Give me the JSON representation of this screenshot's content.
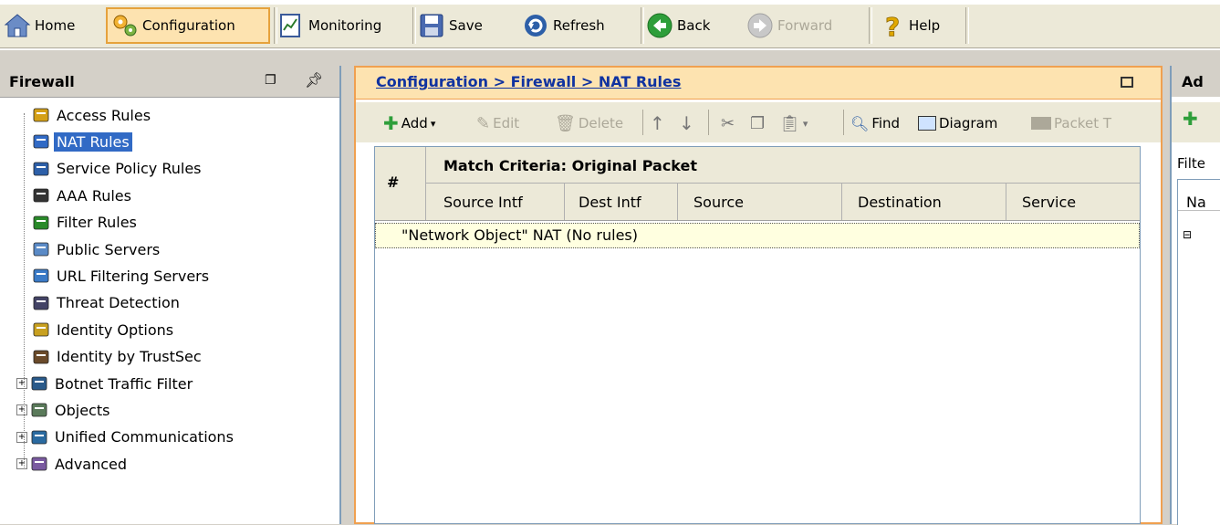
{
  "toolbar": {
    "home": "Home",
    "configuration": "Configuration",
    "monitoring": "Monitoring",
    "save": "Save",
    "refresh": "Refresh",
    "back": "Back",
    "forward": "Forward",
    "help": "Help"
  },
  "left": {
    "title": "Firewall",
    "items": [
      {
        "label": "Access Rules",
        "icon": "access-rules-icon"
      },
      {
        "label": "NAT Rules",
        "icon": "nat-rules-icon",
        "selected": true
      },
      {
        "label": "Service Policy Rules",
        "icon": "magnifier-icon"
      },
      {
        "label": "AAA Rules",
        "icon": "lock-icon"
      },
      {
        "label": "Filter Rules",
        "icon": "filter-icon"
      },
      {
        "label": "Public Servers",
        "icon": "server-icon"
      },
      {
        "label": "URL Filtering Servers",
        "icon": "url-icon"
      },
      {
        "label": "Threat Detection",
        "icon": "threat-icon"
      },
      {
        "label": "Identity Options",
        "icon": "identity-icon"
      },
      {
        "label": "Identity by TrustSec",
        "icon": "trustsec-icon"
      },
      {
        "label": "Botnet Traffic Filter",
        "icon": "botnet-icon",
        "expandable": true
      },
      {
        "label": "Objects",
        "icon": "objects-icon",
        "expandable": true
      },
      {
        "label": "Unified Communications",
        "icon": "uc-icon",
        "expandable": true
      },
      {
        "label": "Advanced",
        "icon": "advanced-icon",
        "expandable": true
      }
    ]
  },
  "center": {
    "breadcrumb": "Configuration > Firewall > NAT Rules",
    "actions": {
      "add": "Add",
      "edit": "Edit",
      "delete": "Delete",
      "find": "Find",
      "diagram": "Diagram",
      "packet": "Packet T"
    },
    "table": {
      "num_header": "#",
      "group_header": "Match Criteria: Original Packet",
      "columns": [
        "Source Intf",
        "Dest Intf",
        "Source",
        "Destination",
        "Service"
      ],
      "group_row": "\"Network Object\" NAT (No rules)"
    }
  },
  "right": {
    "title": "Ad",
    "filter": "Filte",
    "col": "Na"
  },
  "colors": {
    "accent_orange": "#f0a050",
    "selection_blue": "#316ac5",
    "link_blue": "#1033a0"
  }
}
